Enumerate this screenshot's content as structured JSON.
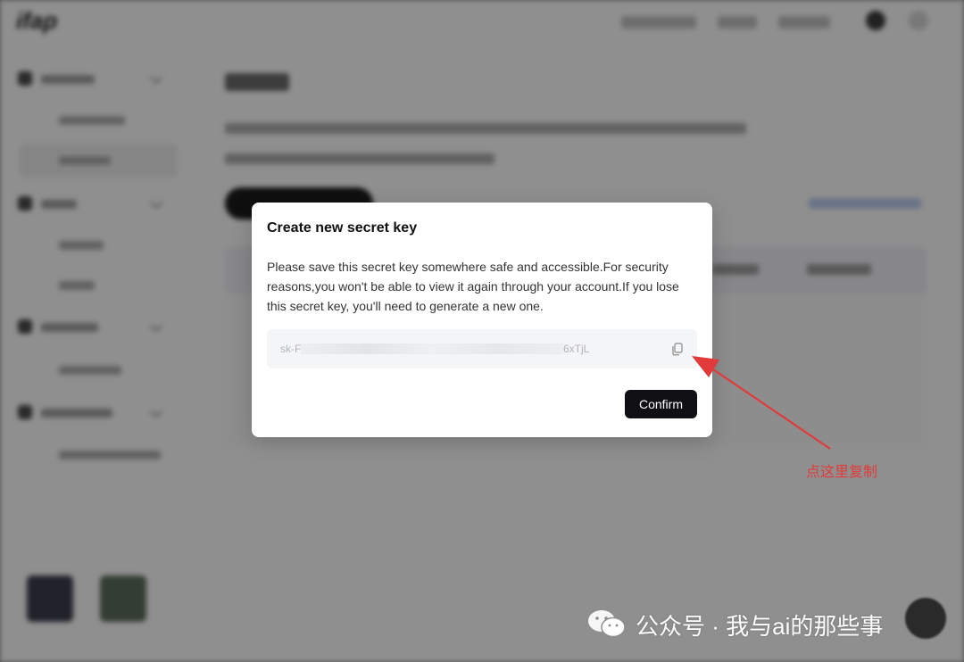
{
  "modal": {
    "title": "Create new secret key",
    "description": "Please save this secret key somewhere safe and accessible.For security reasons,you won't be able to view it again through your account.If you lose this secret key, you'll need to generate a new one.",
    "key_prefix": "sk-F",
    "key_suffix": "6xTjL",
    "confirm_label": "Confirm",
    "copy_icon": "copy-icon"
  },
  "annotation": {
    "text": "点这里复制",
    "color": "#e23a3a"
  },
  "watermark": {
    "text": "公众号 · 我与ai的那些事",
    "icon": "wechat-icon"
  },
  "background": {
    "logo": "ifap",
    "blurred": true
  }
}
